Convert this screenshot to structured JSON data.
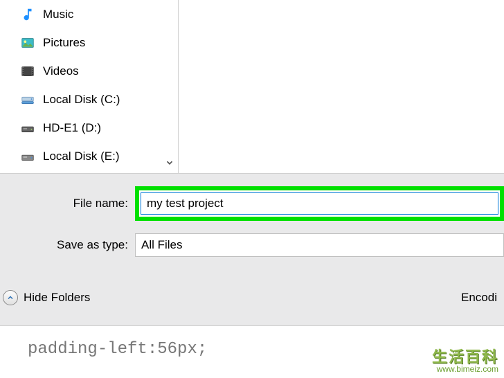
{
  "sidebar": {
    "items": [
      {
        "label": "Music"
      },
      {
        "label": "Pictures"
      },
      {
        "label": "Videos"
      },
      {
        "label": "Local Disk (C:)"
      },
      {
        "label": "HD-E1 (D:)"
      },
      {
        "label": "Local Disk (E:)"
      }
    ]
  },
  "fields": {
    "filename_label": "File name:",
    "filename_value": "my test project",
    "savetype_label": "Save as type:",
    "savetype_value": "All Files"
  },
  "bottom": {
    "hide_folders_label": "Hide Folders",
    "encoding_label": "Encodi"
  },
  "code_behind": "padding-left:56px;",
  "watermark": {
    "line1": "生活百科",
    "line2": "www.bimeiz.com"
  }
}
